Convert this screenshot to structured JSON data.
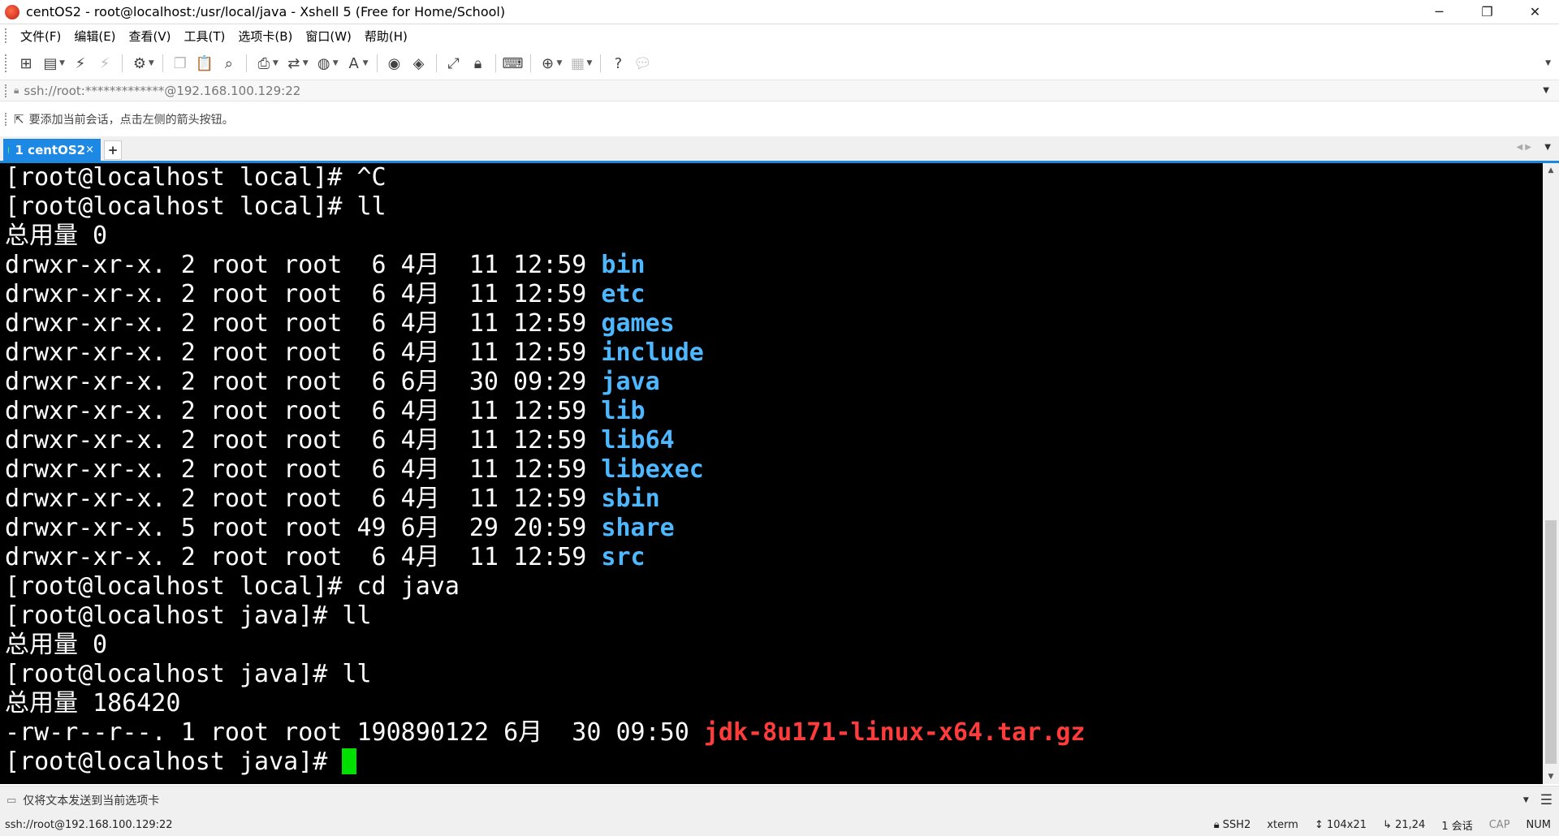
{
  "window": {
    "title": "centOS2 - root@localhost:/usr/local/java - Xshell 5 (Free for Home/School)",
    "controls": [
      "─",
      "❐",
      "✕"
    ]
  },
  "menu": [
    "文件(F)",
    "编辑(E)",
    "查看(V)",
    "工具(T)",
    "选项卡(B)",
    "窗口(W)",
    "帮助(H)"
  ],
  "toolbar": {
    "icons": [
      "new-session",
      "open-folder",
      "reconnect",
      "disconnect",
      "properties",
      "copy",
      "paste",
      "find",
      "print",
      "transfer",
      "globe",
      "font",
      "xftp",
      "xmanager",
      "fullscreen",
      "lock",
      "keyboard",
      "compose",
      "layout",
      "help",
      "chat"
    ]
  },
  "address": {
    "text": "ssh://root:*************@192.168.100.129:22"
  },
  "hint": {
    "text": "要添加当前会话，点击左侧的箭头按钮。"
  },
  "tabs": [
    {
      "label": "1 centOS2",
      "active": true
    }
  ],
  "colors": {
    "tab": "#1e88e5",
    "dir": "#4db8ff",
    "archive": "#ff3b3b",
    "cursor": "#00e000",
    "terminal_bg": "#000000"
  },
  "terminal": {
    "lines": [
      {
        "plain": "[root@localhost local]# ^C"
      },
      {
        "plain": "[root@localhost local]# ll"
      },
      {
        "plain": "总用量 0"
      },
      {
        "plain": "drwxr-xr-x. 2 root root  6 4月  11 12:59 ",
        "blue": "bin"
      },
      {
        "plain": "drwxr-xr-x. 2 root root  6 4月  11 12:59 ",
        "blue": "etc"
      },
      {
        "plain": "drwxr-xr-x. 2 root root  6 4月  11 12:59 ",
        "blue": "games"
      },
      {
        "plain": "drwxr-xr-x. 2 root root  6 4月  11 12:59 ",
        "blue": "include"
      },
      {
        "plain": "drwxr-xr-x. 2 root root  6 6月  30 09:29 ",
        "blue": "java"
      },
      {
        "plain": "drwxr-xr-x. 2 root root  6 4月  11 12:59 ",
        "blue": "lib"
      },
      {
        "plain": "drwxr-xr-x. 2 root root  6 4月  11 12:59 ",
        "blue": "lib64"
      },
      {
        "plain": "drwxr-xr-x. 2 root root  6 4月  11 12:59 ",
        "blue": "libexec"
      },
      {
        "plain": "drwxr-xr-x. 2 root root  6 4月  11 12:59 ",
        "blue": "sbin"
      },
      {
        "plain": "drwxr-xr-x. 5 root root 49 6月  29 20:59 ",
        "blue": "share"
      },
      {
        "plain": "drwxr-xr-x. 2 root root  6 4月  11 12:59 ",
        "blue": "src"
      },
      {
        "plain": "[root@localhost local]# cd java"
      },
      {
        "plain": "[root@localhost java]# ll"
      },
      {
        "plain": "总用量 0"
      },
      {
        "plain": "[root@localhost java]# ll"
      },
      {
        "plain": "总用量 186420"
      },
      {
        "plain": "-rw-r--r--. 1 root root 190890122 6月  30 09:50 ",
        "red": "jdk-8u171-linux-x64.tar.gz"
      },
      {
        "plain": "[root@localhost java]# ",
        "cursor": true
      }
    ]
  },
  "compose": {
    "text": "仅将文本发送到当前选项卡"
  },
  "status": {
    "connection": "ssh://root@192.168.100.129:22",
    "protocol": "SSH2",
    "term": "xterm",
    "size": "104x21",
    "position": "21,24",
    "sessions": "1 会话",
    "cap": "CAP",
    "num": "NUM"
  }
}
